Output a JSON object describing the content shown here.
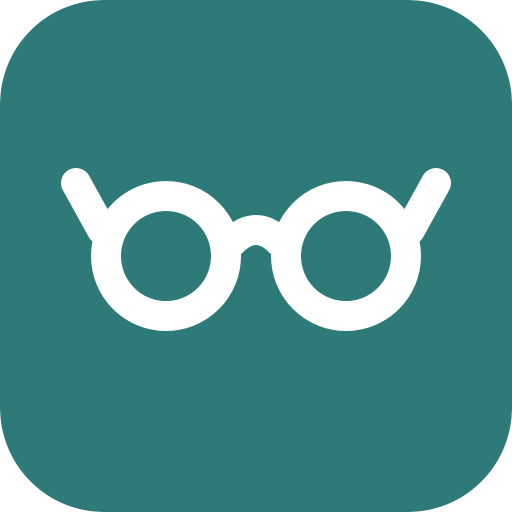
{
  "app_icon": {
    "name": "glasses-app-icon",
    "icon": "glasses-icon",
    "background_color": "#2D7A78",
    "glyph_color": "#FFFFFF"
  }
}
